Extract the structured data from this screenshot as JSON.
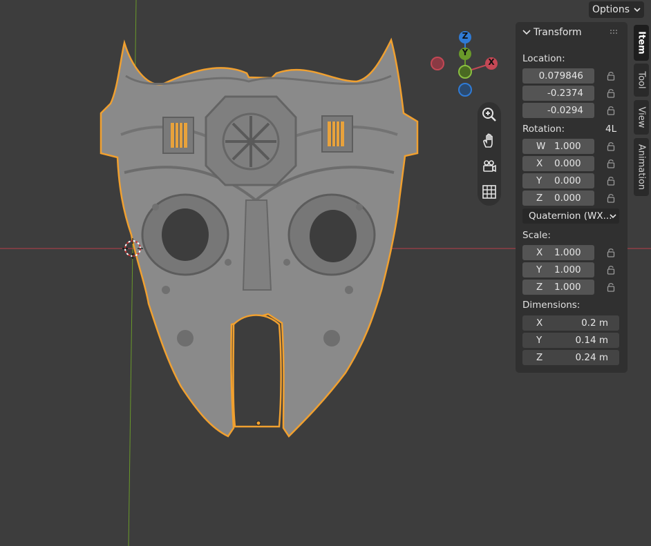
{
  "header": {
    "options_label": "Options"
  },
  "transform_panel": {
    "title": "Transform",
    "location": {
      "label": "Location:",
      "values": [
        "0.079846",
        "-0.2374",
        "-0.0294"
      ]
    },
    "rotation": {
      "label": "Rotation:",
      "mode": "4L",
      "rows": [
        {
          "axis": "W",
          "value": "1.000"
        },
        {
          "axis": "X",
          "value": "0.000"
        },
        {
          "axis": "Y",
          "value": "0.000"
        },
        {
          "axis": "Z",
          "value": "0.000"
        }
      ],
      "mode_dropdown": "Quaternion (WX..."
    },
    "scale": {
      "label": "Scale:",
      "rows": [
        {
          "axis": "X",
          "value": "1.000"
        },
        {
          "axis": "Y",
          "value": "1.000"
        },
        {
          "axis": "Z",
          "value": "1.000"
        }
      ]
    },
    "dimensions": {
      "label": "Dimensions:",
      "rows": [
        {
          "axis": "X",
          "value": "0.2 m"
        },
        {
          "axis": "Y",
          "value": "0.14 m"
        },
        {
          "axis": "Z",
          "value": "0.24 m"
        }
      ]
    }
  },
  "side_tabs": [
    "Item",
    "Tool",
    "View",
    "Animation"
  ],
  "gizmo": {
    "z_label": "Z",
    "y_label": "Y",
    "x_label": "X"
  },
  "nav_tools": [
    "zoom-icon",
    "pan-hand-icon",
    "camera-view-icon",
    "ortho-grid-icon"
  ],
  "colors": {
    "x_axis": "#c44855",
    "y_axis": "#6a9a2a",
    "z_axis": "#2f7bd6",
    "selection_outline": "#f0a030",
    "viewport_bg": "#3d3d3d"
  }
}
